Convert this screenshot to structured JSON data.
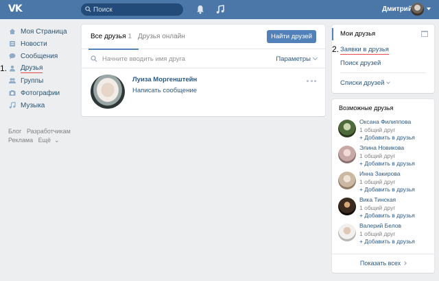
{
  "header": {
    "logo_text": "VK",
    "search_placeholder": "Поиск",
    "user_name": "Дмитрий"
  },
  "left_menu": {
    "items": [
      {
        "label": "Моя Страница",
        "icon": "home-icon"
      },
      {
        "label": "Новости",
        "icon": "news-icon"
      },
      {
        "label": "Сообщения",
        "icon": "messages-icon"
      },
      {
        "label": "Друзья",
        "icon": "friends-icon"
      },
      {
        "label": "Группы",
        "icon": "groups-icon"
      },
      {
        "label": "Фотографии",
        "icon": "photos-icon"
      },
      {
        "label": "Музыка",
        "icon": "music-icon"
      }
    ],
    "step_marker": "1.",
    "footer": [
      "Блог",
      "Разработчикам",
      "Реклама",
      "Ещё"
    ]
  },
  "main": {
    "tab_all": "Все друзья",
    "tab_all_count": "1",
    "tab_online": "Друзья онлайн",
    "find_button": "Найти друзей",
    "search_placeholder": "Начните вводить имя друга",
    "params_label": "Параметры",
    "friend": {
      "name": "Луиза Моргенштейн",
      "action": "Написать сообщение"
    }
  },
  "right_nav": {
    "my_friends": "Мои друзья",
    "requests": "Заявки в друзья",
    "search": "Поиск друзей",
    "lists": "Списки друзей",
    "step_marker": "2."
  },
  "possible_friends": {
    "title": "Возможные друзья",
    "people": [
      {
        "name": "Оксана Филиппова",
        "mutual": "1 общий друг",
        "add": "Добавить в друзья"
      },
      {
        "name": "Элина Новикова",
        "mutual": "1 общий друг",
        "add": "Добавить в друзья"
      },
      {
        "name": "Инна Закирова",
        "mutual": "1 общий друг",
        "add": "Добавить в друзья"
      },
      {
        "name": "Вика Тинская",
        "mutual": "1 общий друг",
        "add": "Добавить в друзья"
      },
      {
        "name": "Валерий Белов",
        "mutual": "1 общий друг",
        "add": "Добавить в друзья"
      }
    ],
    "show_all": "Показать всех"
  },
  "colors": {
    "header_bg": "#4a76a8",
    "link": "#2a5885",
    "button": "#5181b8",
    "annotation_underline": "#e64646",
    "page_bg": "#edeef0"
  }
}
